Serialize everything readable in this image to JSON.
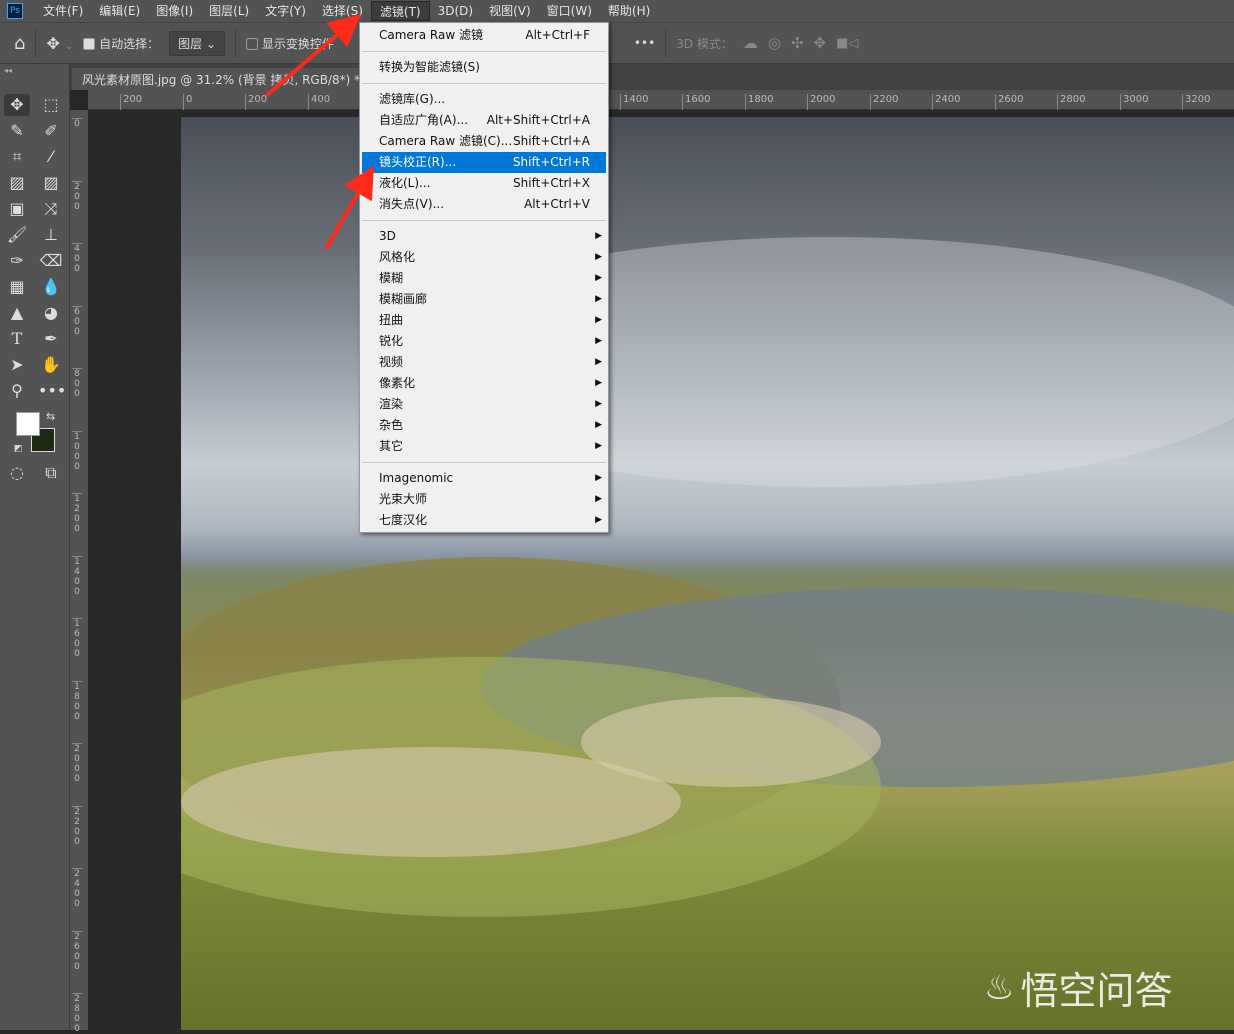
{
  "menubar": {
    "logo": "Ps",
    "items": [
      "文件(F)",
      "编辑(E)",
      "图像(I)",
      "图层(L)",
      "文字(Y)",
      "选择(S)",
      "滤镜(T)",
      "3D(D)",
      "视图(V)",
      "窗口(W)",
      "帮助(H)"
    ]
  },
  "options": {
    "auto_select": "自动选择：",
    "layer_select": "图层",
    "show_transform": "显示变换控件",
    "more": "•••",
    "mode_3d": "3D 模式："
  },
  "document_tab": "风光素材原图.jpg @ 31.2% (背景 拷贝, RGB/8*) *",
  "hruler": [
    "200",
    "0",
    "200",
    "400",
    "1400",
    "1600",
    "1800",
    "2000",
    "2200",
    "2400",
    "2600",
    "2800",
    "3000",
    "3200"
  ],
  "vruler": [
    "0",
    "200",
    "400",
    "600",
    "800",
    "1000",
    "1200",
    "1400",
    "1600",
    "1800",
    "2000",
    "2200",
    "2400",
    "2600",
    "2800"
  ],
  "filter_menu": {
    "group1": [
      {
        "label": "Camera Raw 滤镜",
        "shortcut": "Alt+Ctrl+F"
      }
    ],
    "group2": [
      {
        "label": "转换为智能滤镜(S)",
        "shortcut": ""
      }
    ],
    "group3": [
      {
        "label": "滤镜库(G)...",
        "shortcut": ""
      },
      {
        "label": "自适应广角(A)...",
        "shortcut": "Alt+Shift+Ctrl+A"
      },
      {
        "label": "Camera Raw 滤镜(C)...",
        "shortcut": "Shift+Ctrl+A"
      },
      {
        "label": "镜头校正(R)...",
        "shortcut": "Shift+Ctrl+R",
        "highlighted": true
      },
      {
        "label": "液化(L)...",
        "shortcut": "Shift+Ctrl+X"
      },
      {
        "label": "消失点(V)...",
        "shortcut": "Alt+Ctrl+V"
      }
    ],
    "group4": [
      "3D",
      "风格化",
      "模糊",
      "模糊画廊",
      "扭曲",
      "锐化",
      "视频",
      "像素化",
      "渲染",
      "杂色",
      "其它"
    ],
    "group5": [
      "Imagenomic",
      "光束大师",
      "七度汉化"
    ]
  },
  "colors": {
    "highlight": "#0078d7",
    "arrow": "#ff2a1a",
    "background_swatch": "#1f2a14"
  },
  "watermark": "悟空问答"
}
